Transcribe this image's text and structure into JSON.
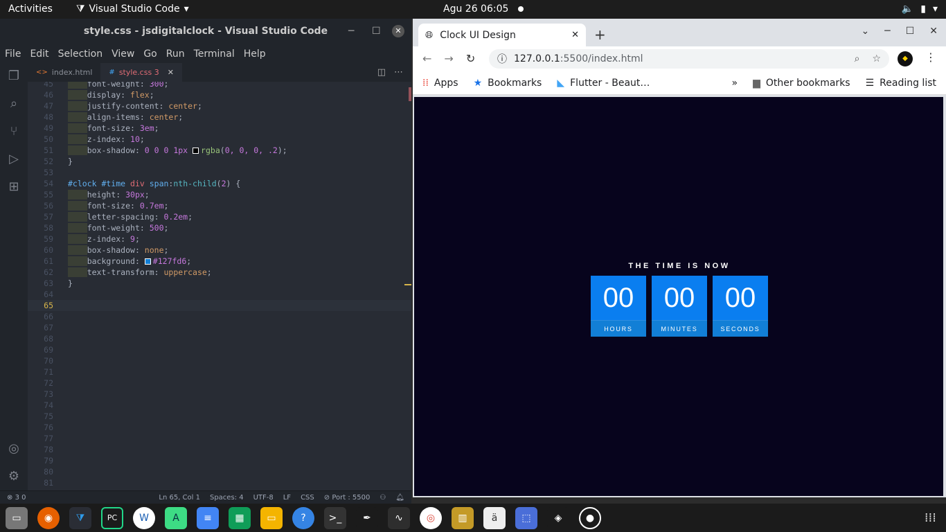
{
  "topbar": {
    "activities": "Activities",
    "app_name": "Visual Studio Code",
    "clock": "Agu 26  06:05"
  },
  "vscode": {
    "title": "style.css - jsdigitalclock - Visual Studio Code",
    "menu": [
      "File",
      "Edit",
      "Selection",
      "View",
      "Go",
      "Run",
      "Terminal",
      "Help"
    ],
    "tabs": [
      {
        "label": "index.html"
      },
      {
        "label": "style.css 3"
      }
    ],
    "status": {
      "problems": "3  0",
      "cursor": "Ln 65, Col 1",
      "spaces": "Spaces: 4",
      "encoding": "UTF-8",
      "eol": "LF",
      "language": "CSS",
      "port": "Port : 5500"
    },
    "current_line": 65
  },
  "chrome": {
    "tab_title": "Clock UI Design",
    "url_host": "127.0.0.1",
    "url_path": ":5500/index.html",
    "bookmarks": [
      "Apps",
      "Bookmarks",
      "Flutter - Beaut…"
    ],
    "other_bookmarks": "Other bookmarks",
    "reading_list": "Reading list"
  },
  "clock": {
    "heading": "THE TIME IS NOW",
    "hours": "00",
    "minutes": "00",
    "seconds": "00",
    "hours_label": "HOURS",
    "minutes_label": "MINUTES",
    "seconds_label": "SECONDS",
    "box_color": "#0a7ef0",
    "label_bg": "#127fd6",
    "page_bg": "#07041d"
  },
  "dock": [
    "files",
    "firefox",
    "vscode",
    "pycharm",
    "wps-writer",
    "android-studio",
    "docs",
    "sheets",
    "slides",
    "help",
    "terminal",
    "inkscape",
    "system-monitor",
    "chrome",
    "archive",
    "text-editor",
    "screenshot",
    "vpn",
    "obs"
  ]
}
